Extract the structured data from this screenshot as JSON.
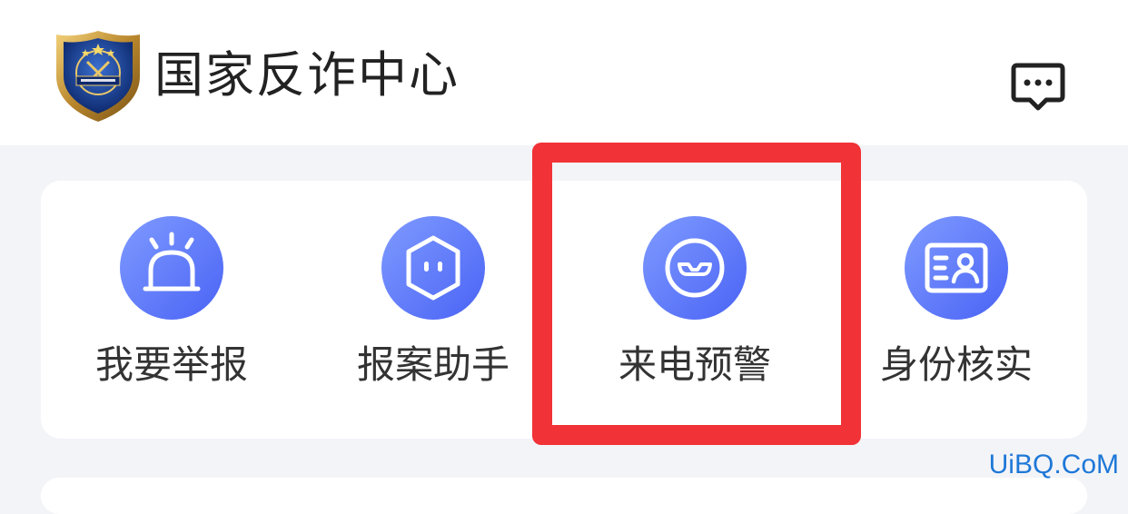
{
  "header": {
    "title": "国家反诈中心",
    "logo_icon": "police-badge-logo",
    "message_icon": "chat-bubble-icon"
  },
  "quick_actions": [
    {
      "label": "我要举报",
      "icon": "alarm-siren-icon"
    },
    {
      "label": "报案助手",
      "icon": "hexagon-robot-icon"
    },
    {
      "label": "来电预警",
      "icon": "mask-eyes-icon"
    },
    {
      "label": "身份核实",
      "icon": "id-card-icon"
    }
  ],
  "highlighted_action": "来电预警",
  "watermark": "UiBQ.CoM",
  "colors": {
    "accent_gradient_start": "#7f9bff",
    "accent_gradient_end": "#4a63f5",
    "highlight_border": "#f13236",
    "page_background": "#f3f4f8",
    "watermark": "#1e78d8"
  }
}
